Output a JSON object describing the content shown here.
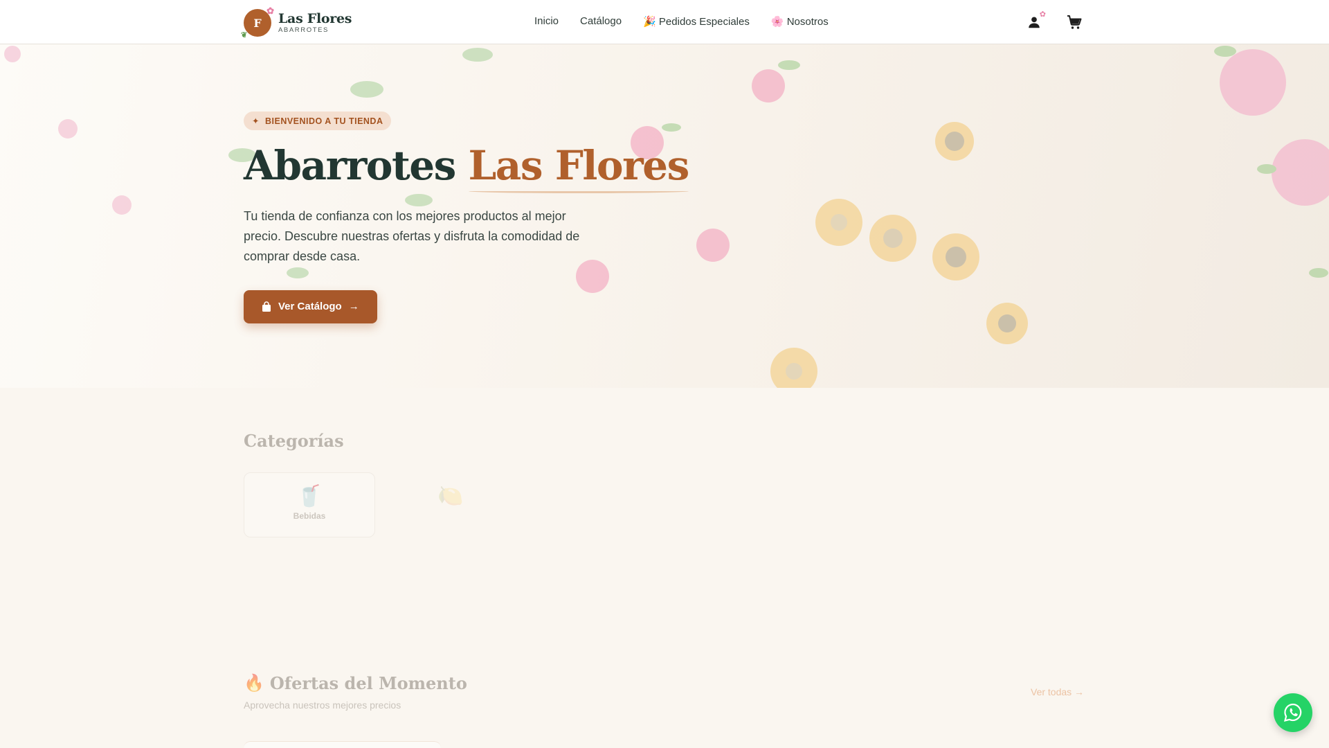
{
  "brand": {
    "initial": "F",
    "name": "Las Flores",
    "subtitle": "ABARROTES"
  },
  "nav": [
    {
      "label": "Inicio"
    },
    {
      "label": "Catálogo"
    },
    {
      "label": "🎉 Pedidos Especiales"
    },
    {
      "label": "🌸 Nosotros"
    }
  ],
  "header_icons": [
    "user-icon",
    "cart-icon"
  ],
  "hero": {
    "badge": "BIENVENIDO A TU TIENDA",
    "title_main": "Abarrotes",
    "title_accent": "Las Flores",
    "lead": "Tu tienda de confianza con los mejores productos al mejor precio. Descubre nuestras ofertas y disfruta la comodidad de comprar desde casa.",
    "cta": "Ver Catálogo"
  },
  "categories": {
    "title": "Categorías",
    "items": [
      {
        "label": "Bebidas",
        "icon": "cup-icon"
      },
      {
        "label": "",
        "icon": "fruit-icon"
      }
    ]
  },
  "offers": {
    "title": "Ofertas del Momento",
    "subtitle": "Aprovecha nuestros mejores precios",
    "see_all": "Ver todas →"
  },
  "colors": {
    "brand": "#b0602c",
    "dark": "#223732",
    "whatsapp": "#25d366"
  }
}
